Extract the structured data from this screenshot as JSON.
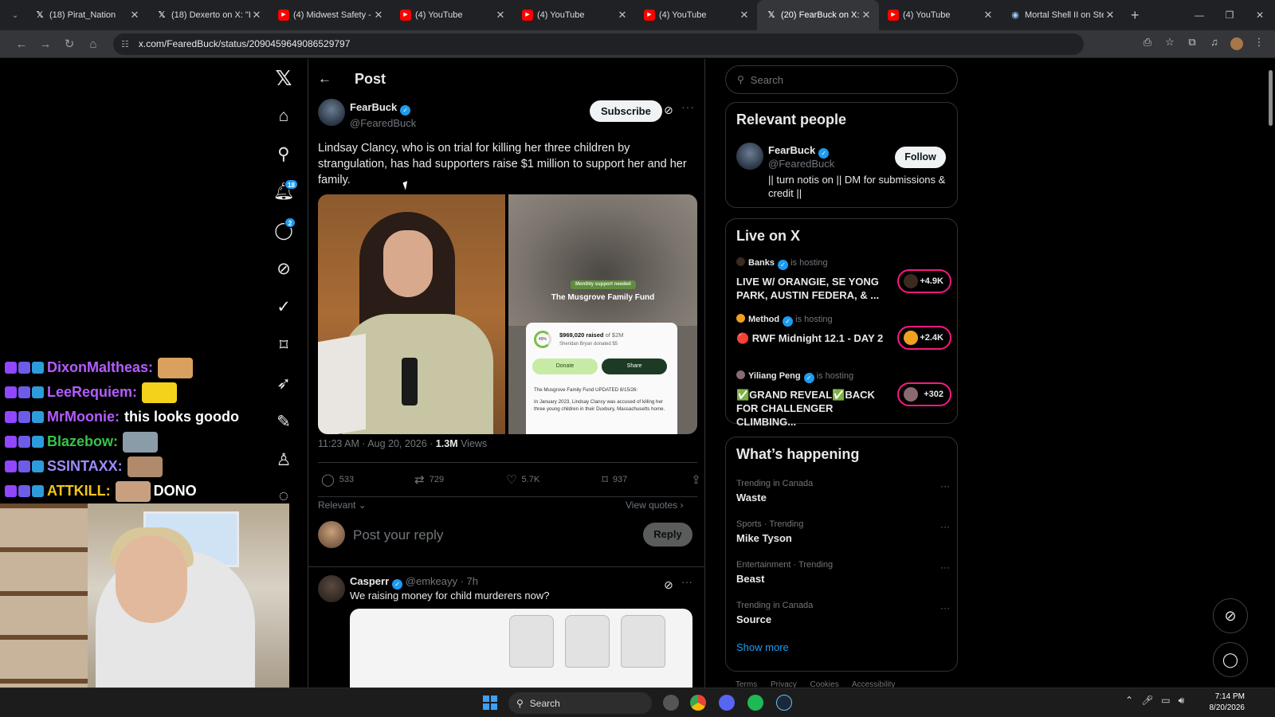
{
  "tabs": [
    {
      "icon": "x",
      "title": "(18) Pirat_Nation"
    },
    {
      "icon": "x",
      "title": "(18) Dexerto on X: \"Li"
    },
    {
      "icon": "yt",
      "title": "(4) Midwest Safety - Y"
    },
    {
      "icon": "yt",
      "title": "(4) YouTube"
    },
    {
      "icon": "yt",
      "title": "(4) YouTube"
    },
    {
      "icon": "yt",
      "title": "(4) YouTube"
    },
    {
      "icon": "x",
      "title": "(20) FearBuck on X: \"I",
      "active": true
    },
    {
      "icon": "yt",
      "title": "(4) YouTube"
    },
    {
      "icon": "steam",
      "title": "Mortal Shell II on Ste"
    }
  ],
  "url": "x.com/FearedBuck/status/2090459649086529797",
  "nav": {
    "notifications_badge": "18",
    "messages_badge": "2"
  },
  "post_header": {
    "title": "Post"
  },
  "post": {
    "display_name": "FearBuck",
    "handle": "@FearedBuck",
    "subscribe_label": "Subscribe",
    "text": "Lindsay Clancy, who is on trial for killing her three children by strangulation, has had supporters raise $1 million to support her and her family.",
    "media2": {
      "pill": "Monthly support needed",
      "fund_name": "The Musgrove Family Fund",
      "percent": "49%",
      "raised": "$969,020 raised",
      "of": "of $2M",
      "donor": "Sheridan Bryan donated $5",
      "donate": "Donate",
      "share": "Share",
      "update": "The Musgrove Family Fund UPDATED 8/15/26:",
      "update2": "In January 2023, Lindsay Clancy was accused of killing her three young children in their Duxbury, Massachusetts home."
    },
    "time": "11:23 AM · Aug 20, 2026 · ",
    "views": "1.3M",
    "views_label": " Views",
    "replies": "533",
    "reposts": "729",
    "likes": "5.7K",
    "bookmarks": "937",
    "sort_label": "Relevant",
    "view_quotes": "View quotes"
  },
  "reply_box": {
    "placeholder": "Post your reply",
    "button": "Reply"
  },
  "reply": {
    "display_name": "Casperr",
    "handle": "@emkeayy",
    "time": "7h",
    "text": "We raising money for child murderers now?"
  },
  "search": {
    "placeholder": "Search"
  },
  "relevant_people": {
    "title": "Relevant people",
    "name": "FearBuck",
    "handle": "@FearedBuck",
    "bio": "|| turn notis on || DM for submissions & credit ||",
    "follow": "Follow"
  },
  "live": {
    "title": "Live on X",
    "items": [
      {
        "host": "Banks",
        "hosting": "is hosting",
        "title": "LIVE W/ ORANGIE, SE YONG PARK, AUSTIN FEDERA, & ...",
        "count": "+4.9K",
        "color": "#3a2a20"
      },
      {
        "host": "Method",
        "hosting": "is hosting",
        "title": "🔴 RWF Midnight 12.1 - DAY 2",
        "count": "+2.4K",
        "color": "#f0a020"
      },
      {
        "host": "Yiliang Peng",
        "hosting": "is hosting",
        "title": "✅GRAND REVEAL✅BACK FOR CHALLENGER CLIMBING...",
        "count": "+302",
        "color": "#8a6a70"
      }
    ]
  },
  "happening": {
    "title": "What’s happening",
    "trends": [
      {
        "cat": "Trending in Canada",
        "name": "Waste"
      },
      {
        "cat": "Sports · Trending",
        "name": "Mike Tyson"
      },
      {
        "cat": "Entertainment · Trending",
        "name": "Beast"
      },
      {
        "cat": "Trending in Canada",
        "name": "Source"
      }
    ],
    "show_more": "Show more"
  },
  "footer": "Terms Privacy Cookies Accessibility",
  "chat": [
    {
      "user": "DixonMaltheas:",
      "color": "#b45cff",
      "msg": "",
      "emote": "#d9a060"
    },
    {
      "user": "LeeRequiem:",
      "color": "#b45cff",
      "msg": "",
      "emote": "#f2d21a"
    },
    {
      "user": "MrMoonie:",
      "color": "#b45cff",
      "msg": "this looks goodo",
      "emote": ""
    },
    {
      "user": "Blazebow:",
      "color": "#39c24a",
      "msg": "",
      "emote": "#8a9ca8"
    },
    {
      "user": "SSINTAXX:",
      "color": "#9b8cff",
      "msg": "",
      "emote": "#b08a6a"
    },
    {
      "user": "ATTKILL:",
      "color": "#f5c518",
      "msg": "DONO",
      "emote": "#c8a080"
    }
  ],
  "taskbar": {
    "search": "Search",
    "time": "7:14 PM",
    "date": "8/20/2026"
  }
}
